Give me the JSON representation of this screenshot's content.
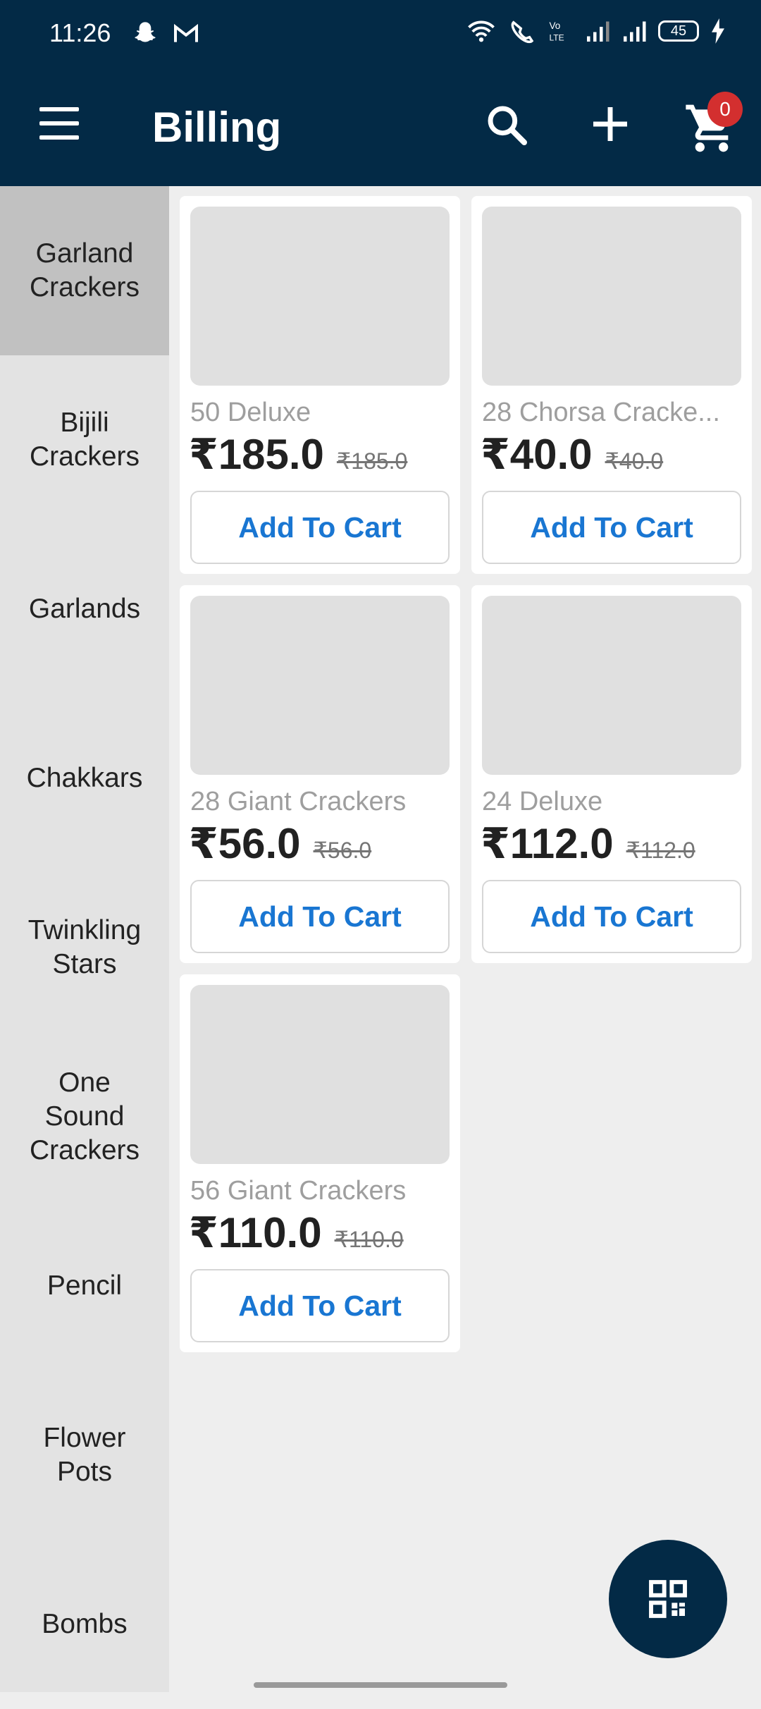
{
  "status_bar": {
    "time": "11:26",
    "battery": "45"
  },
  "app_bar": {
    "title": "Billing",
    "cart_count": "0"
  },
  "categories": [
    {
      "label": "Garland\nCrackers",
      "active": true
    },
    {
      "label": "Bijili\nCrackers"
    },
    {
      "label": "Garlands"
    },
    {
      "label": "Chakkars"
    },
    {
      "label": "Twinkling\nStars"
    },
    {
      "label": "One\nSound\nCrackers"
    },
    {
      "label": "Pencil"
    },
    {
      "label": "Flower\nPots"
    },
    {
      "label": "Bombs"
    }
  ],
  "products": [
    {
      "name": "50 Deluxe",
      "price": "₹185.0",
      "mrp": "₹185.0",
      "button": "Add To Cart"
    },
    {
      "name": "28 Chorsa Cracke...",
      "price": "₹40.0",
      "mrp": "₹40.0",
      "button": "Add To Cart"
    },
    {
      "name": "28 Giant Crackers",
      "price": "₹56.0",
      "mrp": "₹56.0",
      "button": "Add To Cart"
    },
    {
      "name": "24 Deluxe",
      "price": "₹112.0",
      "mrp": "₹112.0",
      "button": "Add To Cart"
    },
    {
      "name": "56 Giant Crackers",
      "price": "₹110.0",
      "mrp": "₹110.0",
      "button": "Add To Cart"
    }
  ],
  "colors": {
    "primary": "#032a46",
    "accent": "#1976d2",
    "badge": "#d32f2f"
  },
  "icons": [
    "menu-icon",
    "search-icon",
    "plus-icon",
    "cart-icon",
    "qr-code-icon"
  ]
}
